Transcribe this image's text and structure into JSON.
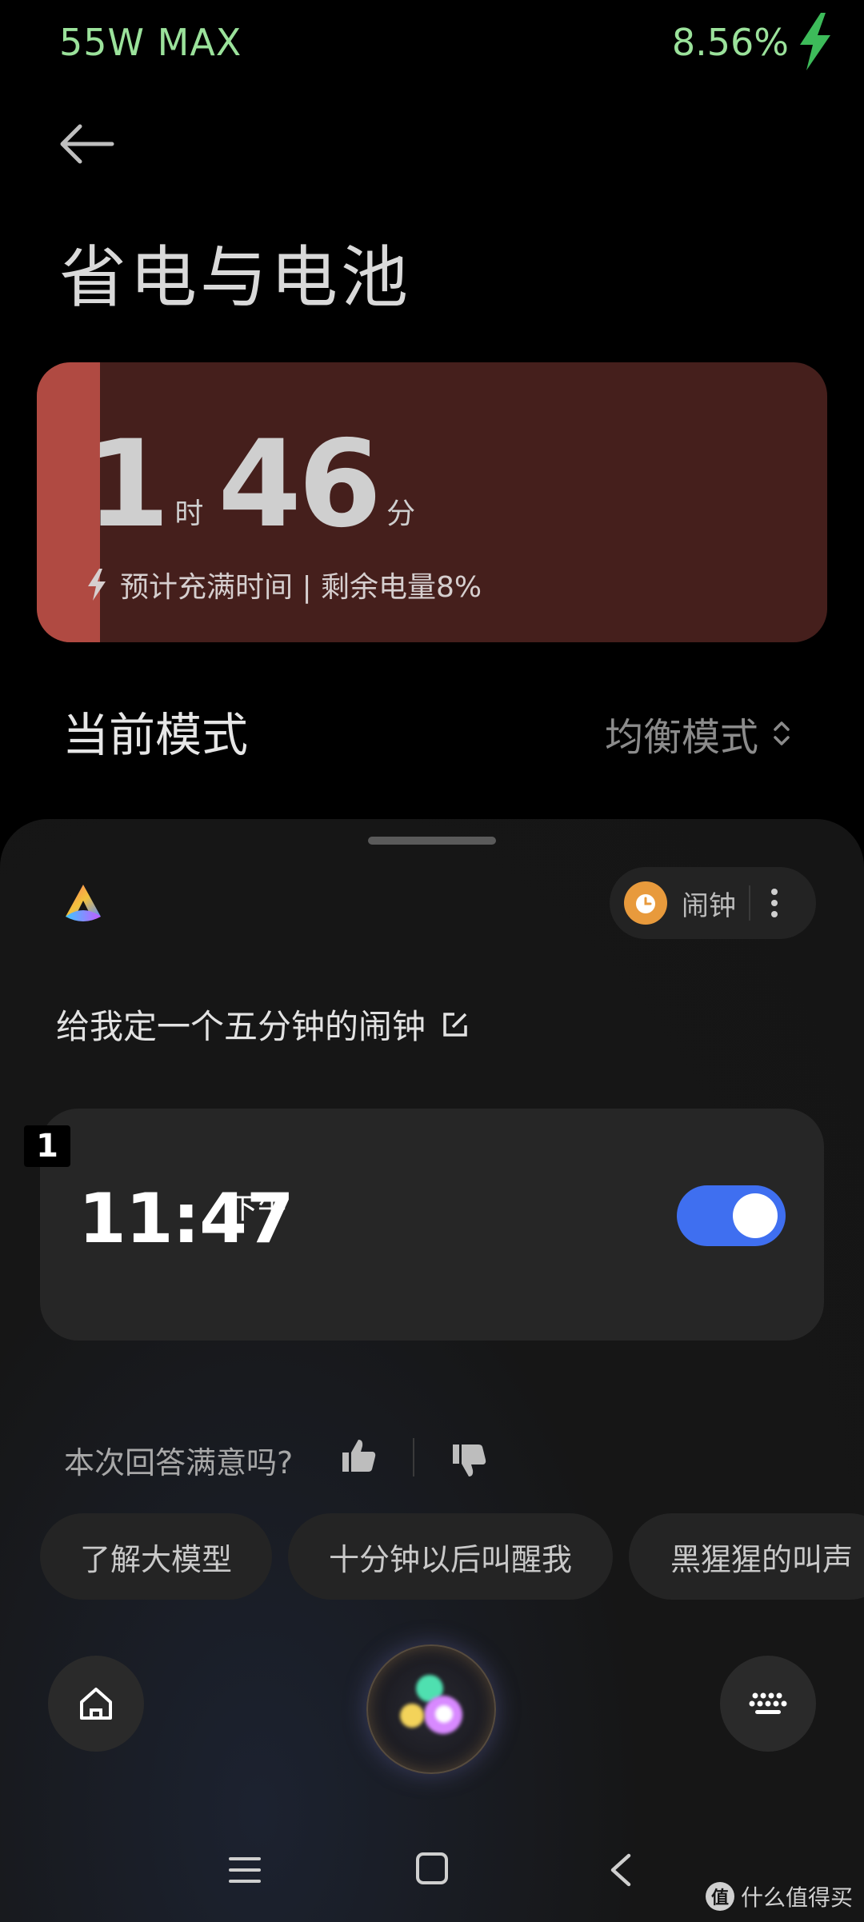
{
  "status_bar": {
    "charging_power": "55W MAX",
    "battery_percent": "8.56%",
    "charging_icon": "lightning-bolt-icon"
  },
  "header": {
    "back_icon": "back-arrow-icon",
    "title": "省电与电池"
  },
  "battery_card": {
    "hours": "1",
    "hours_unit": "时",
    "minutes": "46",
    "minutes_unit": "分",
    "subtitle": "预计充满时间 | 剩余电量8%",
    "level_fraction": 0.08,
    "colors": {
      "card": "#451f1c",
      "fill": "#b04a42"
    }
  },
  "mode": {
    "label": "当前模式",
    "value": "均衡模式"
  },
  "assistant": {
    "chip": {
      "label": "闹钟",
      "icon": "alarm-clock-icon"
    },
    "query": "给我定一个五分钟的闹钟",
    "alarm": {
      "index": "1",
      "time": "11:47",
      "ampm": "下午",
      "enabled": true,
      "toggle_color": "#3f6ff0"
    },
    "feedback": {
      "question": "本次回答满意吗?"
    },
    "suggestions": [
      {
        "label": "了解大模型"
      },
      {
        "label": "十分钟以后叫醒我"
      },
      {
        "label": "黑猩猩的叫声"
      }
    ]
  },
  "watermark": {
    "badge": "值",
    "text": "什么值得买"
  }
}
